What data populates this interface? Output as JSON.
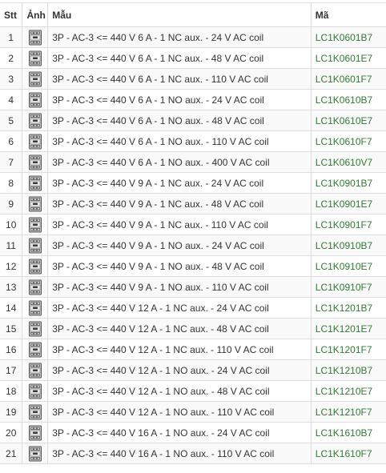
{
  "table": {
    "headers": {
      "stt": "Stt",
      "image": "Ảnh",
      "model": "Mẫu",
      "code": "Mã"
    },
    "thumbnail_icon": "contactor-product-icon",
    "code_color": "#2e7d32",
    "rows": [
      {
        "stt": "1",
        "model": "3P - AC-3 <= 440 V 6 A - 1 NC aux. - 24 V AC coil",
        "code": "LC1K0601B7"
      },
      {
        "stt": "2",
        "model": "3P - AC-3 <= 440 V 6 A - 1 NC aux. - 48 V AC coil",
        "code": "LC1K0601E7"
      },
      {
        "stt": "3",
        "model": "3P - AC-3 <= 440 V 6 A - 1 NC aux. - 110 V AC coil",
        "code": "LC1K0601F7"
      },
      {
        "stt": "4",
        "model": "3P - AC-3 <= 440 V 6 A - 1 NO aux. - 24 V AC coil",
        "code": "LC1K0610B7"
      },
      {
        "stt": "5",
        "model": "3P - AC-3 <= 440 V 6 A - 1 NO aux. - 48 V AC coil",
        "code": "LC1K0610E7"
      },
      {
        "stt": "6",
        "model": "3P - AC-3 <= 440 V 6 A - 1 NO aux. - 110 V AC coil",
        "code": "LC1K0610F7"
      },
      {
        "stt": "7",
        "model": "3P - AC-3 <= 440 V 6 A - 1 NO aux. - 400 V AC coil",
        "code": "LC1K0610V7"
      },
      {
        "stt": "8",
        "model": "3P - AC-3 <= 440 V 9 A - 1 NC aux. - 24 V AC coil",
        "code": "LC1K0901B7"
      },
      {
        "stt": "9",
        "model": "3P - AC-3 <= 440 V 9 A - 1 NC aux. - 48 V AC coil",
        "code": "LC1K0901E7"
      },
      {
        "stt": "10",
        "model": "3P - AC-3 <= 440 V 9 A - 1 NC aux. - 110 V AC coil",
        "code": "LC1K0901F7"
      },
      {
        "stt": "11",
        "model": "3P - AC-3 <= 440 V 9 A - 1 NO aux. - 24 V AC coil",
        "code": "LC1K0910B7"
      },
      {
        "stt": "12",
        "model": "3P - AC-3 <= 440 V 9 A - 1 NO aux. - 48 V AC coil",
        "code": "LC1K0910E7"
      },
      {
        "stt": "13",
        "model": "3P - AC-3 <= 440 V 9 A - 1 NO aux. - 110 V AC coil",
        "code": "LC1K0910F7"
      },
      {
        "stt": "14",
        "model": "3P - AC-3 <= 440 V 12 A - 1 NC aux. - 24 V AC coil",
        "code": "LC1K1201B7"
      },
      {
        "stt": "15",
        "model": "3P - AC-3 <= 440 V 12 A - 1 NC aux. - 48 V AC coil",
        "code": "LC1K1201E7"
      },
      {
        "stt": "16",
        "model": "3P - AC-3 <= 440 V 12 A - 1 NC aux. - 110 V AC coil",
        "code": "LC1K1201F7"
      },
      {
        "stt": "17",
        "model": "3P - AC-3 <= 440 V 12 A - 1 NO aux. - 24 V AC coil",
        "code": "LC1K1210B7"
      },
      {
        "stt": "18",
        "model": "3P - AC-3 <= 440 V 12 A - 1 NO aux. - 48 V AC coil",
        "code": "LC1K1210E7"
      },
      {
        "stt": "19",
        "model": "3P - AC-3 <= 440 V 12 A - 1 NO aux. - 110 V AC coil",
        "code": "LC1K1210F7"
      },
      {
        "stt": "20",
        "model": "3P - AC-3 <= 440 V 16 A - 1 NO aux. - 24 V AC coil",
        "code": "LC1K1610B7"
      },
      {
        "stt": "21",
        "model": "3P - AC-3 <= 440 V 16 A - 1 NO aux. - 110 V AC coil",
        "code": "LC1K1610F7"
      }
    ]
  }
}
